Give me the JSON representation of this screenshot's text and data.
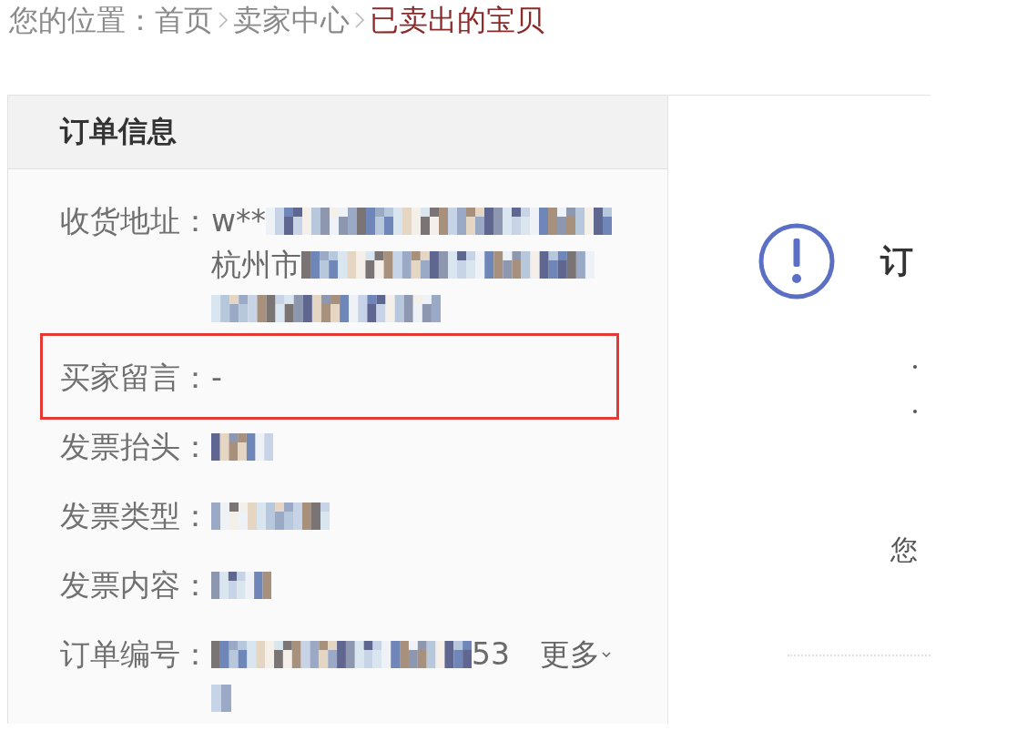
{
  "breadcrumb": {
    "prefix": "您的位置：",
    "items": [
      {
        "label": "首页",
        "current": false
      },
      {
        "label": "卖家中心",
        "current": false
      },
      {
        "label": "已卖出的宝贝",
        "current": true
      }
    ]
  },
  "order_info": {
    "title": "订单信息",
    "rows": [
      {
        "label": "收货地址：",
        "highlighted": false,
        "lines": [
          [
            {
              "kind": "text",
              "text": "w**"
            },
            {
              "kind": "mosaic"
            }
          ],
          [
            {
              "kind": "text",
              "text": "杭州市"
            },
            {
              "kind": "mosaic"
            }
          ],
          [
            {
              "kind": "mosaic"
            }
          ]
        ]
      },
      {
        "label": "买家留言：",
        "highlighted": true,
        "lines": [
          [
            {
              "kind": "text",
              "text": "-"
            }
          ]
        ]
      },
      {
        "label": "发票抬头：",
        "highlighted": false,
        "lines": [
          [
            {
              "kind": "mosaic"
            }
          ]
        ]
      },
      {
        "label": "发票类型：",
        "highlighted": false,
        "lines": [
          [
            {
              "kind": "mosaic"
            }
          ]
        ]
      },
      {
        "label": "发票内容：",
        "highlighted": false,
        "lines": [
          [
            {
              "kind": "mosaic"
            }
          ]
        ]
      },
      {
        "label": "订单编号：",
        "highlighted": false,
        "lines": [
          [
            {
              "kind": "mosaic"
            },
            {
              "kind": "text",
              "text": "53"
            }
          ],
          [
            {
              "kind": "mosaic"
            }
          ]
        ],
        "more_link": "更多"
      }
    ]
  },
  "notice": {
    "title": "订",
    "body": "您"
  }
}
